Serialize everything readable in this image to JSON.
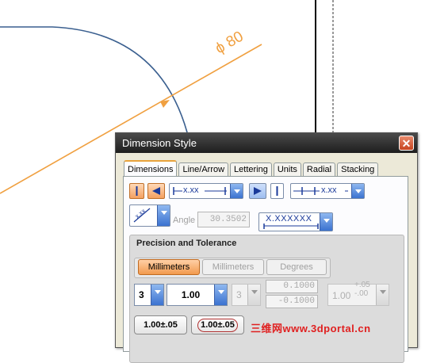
{
  "drawing": {
    "dimension_text": "ϕ 80",
    "colors": {
      "arc": "#3a5f8f",
      "dimension": "#f0a040",
      "border": "#000000"
    }
  },
  "dialog": {
    "title": "Dimension Style",
    "close_icon": "close-icon",
    "tabs": [
      {
        "label": "Dimensions",
        "active": true
      },
      {
        "label": "Line/Arrow",
        "active": false
      },
      {
        "label": "Lettering",
        "active": false
      },
      {
        "label": "Units",
        "active": false
      },
      {
        "label": "Radial",
        "active": false
      },
      {
        "label": "Stacking",
        "active": false
      }
    ],
    "row1": {
      "left_placement_text": "x.xx",
      "right_placement_text": "x.xx"
    },
    "angle": {
      "label": "Angle",
      "value": "30.3502"
    },
    "text_preview": "X.XXXXXX",
    "precision": {
      "group_title": "Precision and Tolerance",
      "unit_buttons": [
        {
          "label": "Millimeters",
          "selected": true
        },
        {
          "label": "Millimeters",
          "selected": false
        },
        {
          "label": "Degrees",
          "selected": false
        }
      ],
      "decimals": "3",
      "nominal_value": "1.00",
      "tolerance_decimals": "3",
      "upper_tol": "0.1000",
      "lower_tol": "-0.1000",
      "tol_preview_base": "1.00",
      "tol_preview_upper": "+.05",
      "tol_preview_lower": "-.00",
      "style_buttons": [
        "1.00±.05",
        "1.00±.05"
      ]
    }
  },
  "watermark": "三维网www.3dportal.cn"
}
